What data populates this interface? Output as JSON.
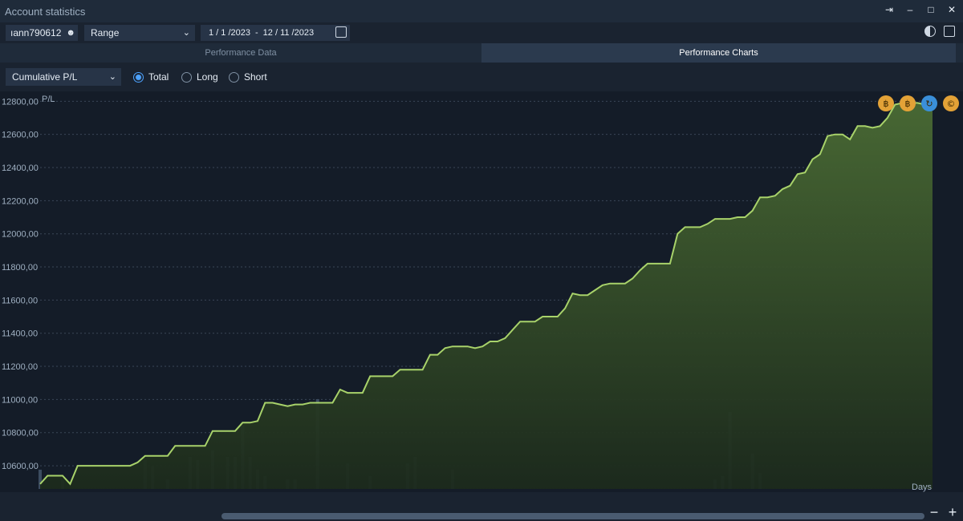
{
  "window": {
    "title": "Account statistics",
    "controls": [
      "pin-icon",
      "minimize-icon",
      "maximize-icon",
      "close-icon"
    ]
  },
  "toolbar": {
    "account": "ıann790612",
    "range_label": "Range",
    "date_from": "1 / 1 /2023",
    "date_separator": "-",
    "date_to": "12 / 11 /2023"
  },
  "tabs": [
    {
      "label": "Performance Data",
      "active": false
    },
    {
      "label": "Performance Charts",
      "active": true
    }
  ],
  "filters": {
    "metric": "Cumulative P/L",
    "options": [
      {
        "label": "Total",
        "selected": true
      },
      {
        "label": "Long",
        "selected": false
      },
      {
        "label": "Short",
        "selected": false
      }
    ]
  },
  "colors": {
    "line": "#a8d26a",
    "area_top": "#4a6b34",
    "area_bottom": "#1c2a1c",
    "bar": "#3c4c60",
    "grid": "#3a4657",
    "accent_radio": "#4da3ff",
    "chart_bg": "#141c28",
    "badge_orange": "#e3a237",
    "badge_blue": "#3a8fd9"
  },
  "chart_data": {
    "type": "area",
    "ylabel": "P/L",
    "xlabel": "Days",
    "ylim": [
      10460,
      12850
    ],
    "y_ticks": [
      "12800,00",
      "12600,00",
      "12400,00",
      "12200,00",
      "12000,00",
      "11800,00",
      "11600,00",
      "11400,00",
      "11200,00",
      "11000,00",
      "10800,00",
      "10600,00"
    ],
    "y_tick_values": [
      12800,
      12600,
      12400,
      12200,
      12000,
      11800,
      11600,
      11400,
      11200,
      11000,
      10800,
      10600
    ],
    "grid": true,
    "series": [
      {
        "values": [
          10490,
          10540,
          10540,
          10540,
          10490,
          10600,
          10600,
          10600,
          10600,
          10600,
          10600,
          10600,
          10600,
          10620,
          10660,
          10660,
          10660,
          10660,
          10720,
          10720,
          10720,
          10720,
          10720,
          10810,
          10810,
          10810,
          10810,
          10860,
          10860,
          10870,
          10980,
          10980,
          10970,
          10960,
          10970,
          10970,
          10980,
          10980,
          10980,
          10980,
          11060,
          11040,
          11040,
          11040,
          11140,
          11140,
          11140,
          11140,
          11180,
          11180,
          11180,
          11180,
          11270,
          11270,
          11310,
          11320,
          11320,
          11320,
          11310,
          11320,
          11350,
          11350,
          11370,
          11420,
          11470,
          11470,
          11470,
          11500,
          11500,
          11500,
          11550,
          11640,
          11630,
          11630,
          11660,
          11690,
          11700,
          11700,
          11700,
          11730,
          11780,
          11820,
          11820,
          11820,
          11820,
          12000,
          12040,
          12040,
          12040,
          12060,
          12090,
          12090,
          12090,
          12100,
          12100,
          12140,
          12220,
          12220,
          12230,
          12270,
          12290,
          12360,
          12370,
          12450,
          12480,
          12590,
          12600,
          12600,
          12570,
          12650,
          12650,
          12640,
          12650,
          12700,
          12780,
          12790,
          12790,
          12790,
          12780,
          12780
        ]
      }
    ],
    "volume_bars": [
      60,
      0,
      0,
      30,
      0,
      0,
      0,
      0,
      0,
      0,
      0,
      0,
      0,
      0,
      90,
      70,
      0,
      30,
      0,
      0,
      100,
      90,
      0,
      120,
      0,
      100,
      100,
      200,
      100,
      60,
      40,
      0,
      0,
      30,
      30,
      0,
      0,
      280,
      0,
      0,
      0,
      80,
      0,
      0,
      40,
      0,
      0,
      0,
      0,
      80,
      100,
      0,
      0,
      0,
      0,
      60,
      0,
      0,
      0,
      0,
      0,
      0,
      0,
      0,
      0,
      0,
      0,
      0,
      0,
      0,
      0,
      0,
      0,
      0,
      0,
      0,
      0,
      0,
      0,
      0,
      0,
      0,
      0,
      0,
      0,
      0,
      0,
      0,
      0,
      0,
      30,
      40,
      240,
      0,
      0,
      110,
      50,
      0,
      0,
      0,
      0,
      0,
      0,
      0,
      0,
      0,
      0,
      0,
      0,
      0,
      0,
      0,
      0,
      0,
      0,
      0,
      0,
      0,
      0,
      0
    ],
    "badges": [
      "bitcoin-badge",
      "bitcoin-badge-alt",
      "refresh-badge",
      "copyright-badge"
    ]
  },
  "scroll": {
    "zoom_out": "−",
    "zoom_in": "+"
  }
}
